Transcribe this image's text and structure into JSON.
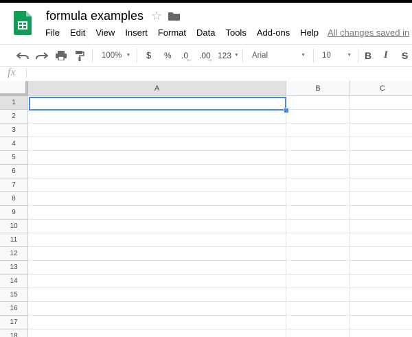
{
  "document": {
    "title": "formula examples"
  },
  "menu": {
    "items": [
      "File",
      "Edit",
      "View",
      "Insert",
      "Format",
      "Data",
      "Tools",
      "Add-ons",
      "Help"
    ],
    "save_status": "All changes saved in"
  },
  "toolbar": {
    "zoom": "100%",
    "currency_label": "$",
    "percent_label": "%",
    "decrease_decimal_label": ".0",
    "increase_decimal_label": ".00",
    "more_formats_label": "123",
    "font": "Arial",
    "font_size": "10",
    "bold_label": "B",
    "italic_label": "I",
    "strike_label": "S"
  },
  "formula_bar": {
    "fx_label": "fx",
    "value": ""
  },
  "sheet": {
    "columns": [
      "A",
      "B",
      "C"
    ],
    "rows": [
      "1",
      "2",
      "3",
      "4",
      "5",
      "6",
      "7",
      "8",
      "9",
      "10",
      "11",
      "12",
      "13",
      "14",
      "15",
      "16",
      "17",
      "18"
    ],
    "selected_cell": "A1"
  },
  "colors": {
    "accent": "#4285f4",
    "sheets_green": "#0f9d58"
  }
}
